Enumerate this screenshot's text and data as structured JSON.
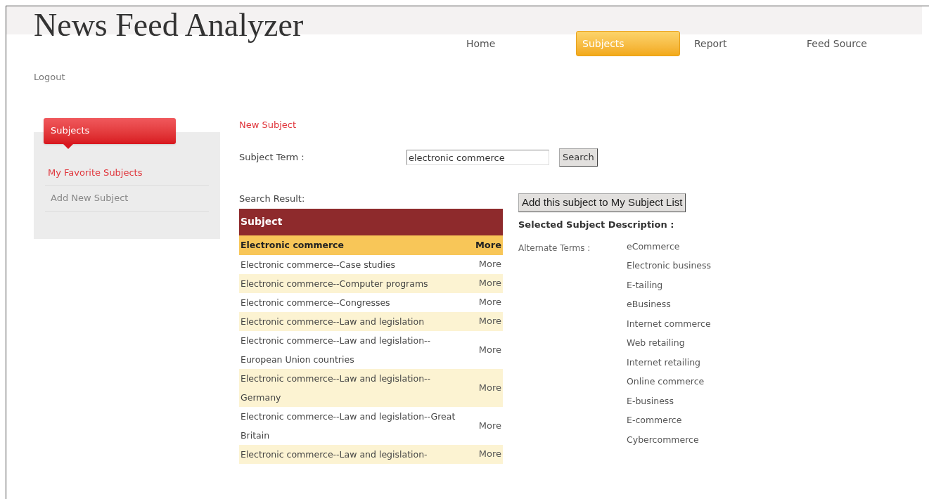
{
  "title": "News Feed Analyzer",
  "nav": [
    {
      "label": "Home",
      "selected": false
    },
    {
      "label": "Subjects",
      "selected": true
    },
    {
      "label": "Report",
      "selected": false
    },
    {
      "label": "Feed Source",
      "selected": false
    }
  ],
  "logout": "Logout",
  "sidebar": {
    "heading": "Subjects",
    "items": [
      {
        "label": "My Favorite Subjects",
        "selected": true
      },
      {
        "label": "Add New Subject",
        "selected": false
      }
    ]
  },
  "main": {
    "heading": "New Subject",
    "term_label": "Subject Term :",
    "term_value": "electronic commerce",
    "search_button": "Search",
    "result_label": "Search Result:",
    "table": {
      "column": "Subject",
      "rows": [
        {
          "subject": "Electronic commerce",
          "more": "More",
          "selected": true
        },
        {
          "subject": "Electronic commerce--Case studies",
          "more": "More",
          "selected": false
        },
        {
          "subject": "Electronic commerce--Computer programs",
          "more": "More",
          "selected": false
        },
        {
          "subject": "Electronic commerce--Congresses",
          "more": "More",
          "selected": false
        },
        {
          "subject": "Electronic commerce--Law and legislation",
          "more": "More",
          "selected": false
        },
        {
          "subject": "Electronic commerce--Law and legislation--European Union countries",
          "more": "More",
          "selected": false
        },
        {
          "subject": "Electronic commerce--Law and legislation--Germany",
          "more": "More",
          "selected": false
        },
        {
          "subject": "Electronic commerce--Law and legislation--Great Britain",
          "more": "More",
          "selected": false
        },
        {
          "subject": "Electronic commerce--Law and legislation-",
          "more": "More",
          "selected": false
        }
      ]
    }
  },
  "details": {
    "add_button": "Add this subject to My Subject List",
    "heading": "Selected Subject Description :",
    "alt_label": "Alternate Terms :",
    "alt_terms": [
      "eCommerce",
      "Electronic business",
      "E-tailing",
      "eBusiness",
      "Internet commerce",
      "Web retailing",
      "Internet retailing",
      "Online commerce",
      "E-business",
      "E-commerce",
      "Cybercommerce"
    ]
  }
}
